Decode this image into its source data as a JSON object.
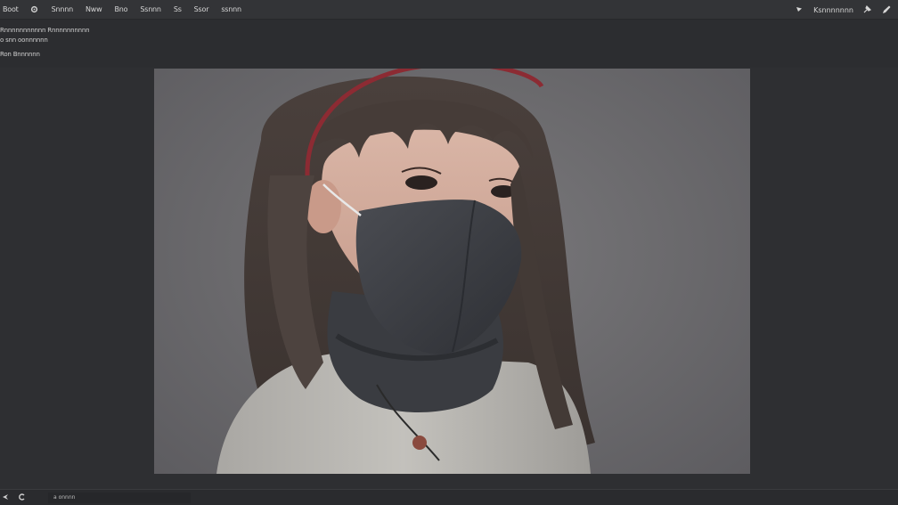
{
  "menubar": {
    "items": [
      "Boot",
      "Snnnn",
      "Nww",
      "Bno",
      "Ssnnn",
      "Ss",
      "Ssor",
      "ssnnn"
    ],
    "right_label": "Ksnnnnnnn"
  },
  "info_panel": {
    "line1": "Rnnnnnnnnnnn Rnnnnnnnnnn",
    "line2": "o snn oonnnnnn",
    "line3": "Ron Bnnnnnn"
  },
  "statusbar": {
    "field_text": "a onnnn"
  },
  "colors": {
    "background": "#2b2c2f",
    "menubar": "#333437",
    "canvas_bg": "#6a696c",
    "mask": "#3a3c41",
    "sweater": "#b9b7b2",
    "headband": "#8c2b33"
  },
  "icons": {
    "gear": "gear-icon",
    "triangle": "triangle-cursor-icon",
    "pin": "pin-icon",
    "pen": "pen-icon",
    "status_left": "arrow-icon",
    "status_c": "c-icon"
  }
}
